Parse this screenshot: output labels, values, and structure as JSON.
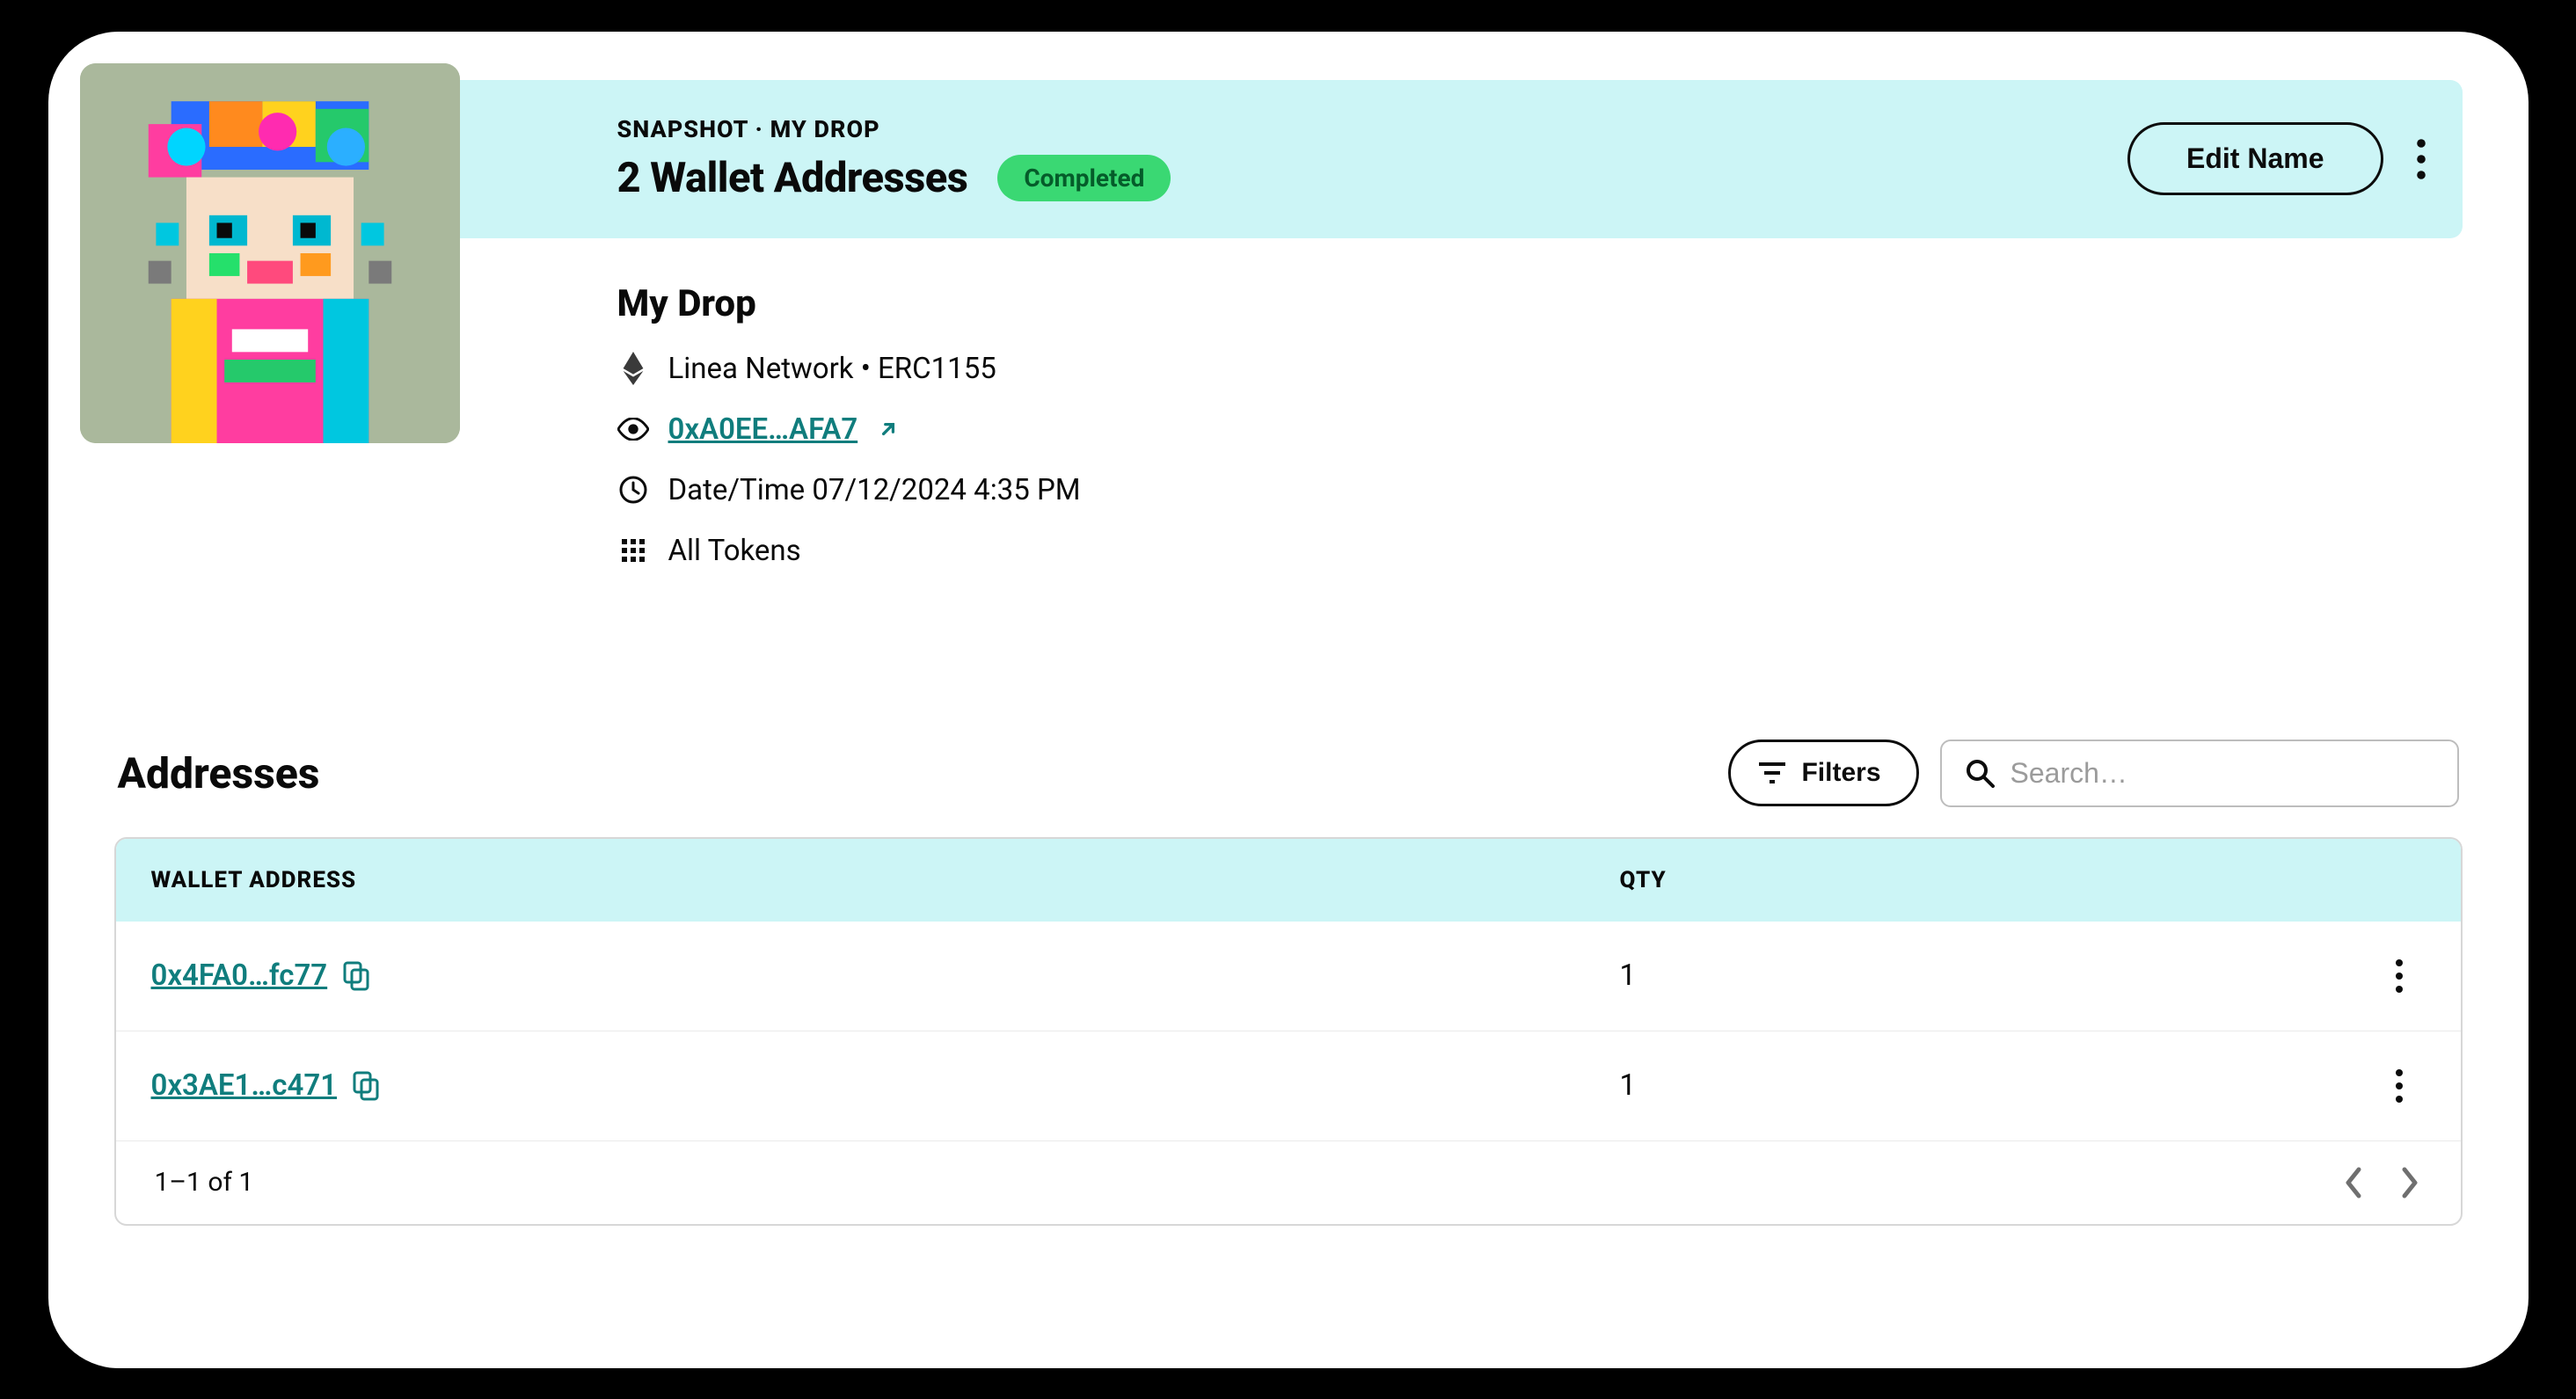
{
  "banner": {
    "breadcrumb": "SNAPSHOT · MY DROP",
    "title": "2 Wallet Addresses",
    "status": "Completed",
    "edit_label": "Edit Name"
  },
  "details": {
    "name": "My Drop",
    "network": "Linea Network • ERC1155",
    "contract": "0xA0EE…AFA7",
    "datetime_label": "Date/Time 07/12/2024 4:35 PM",
    "tokens_label": "All Tokens"
  },
  "addresses": {
    "heading": "Addresses",
    "filters_label": "Filters",
    "search_placeholder": "Search…",
    "columns": {
      "wallet": "WALLET ADDRESS",
      "qty": "QTY"
    },
    "rows": [
      {
        "address": "0x4FA0…fc77",
        "qty": "1"
      },
      {
        "address": "0x3AE1…c471",
        "qty": "1"
      }
    ],
    "pagination": "1–1 of 1"
  }
}
